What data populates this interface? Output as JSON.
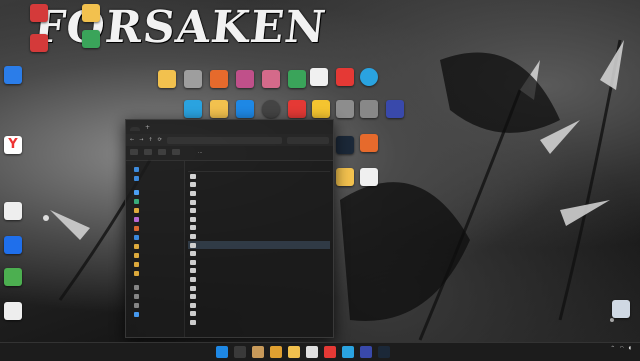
{
  "wallpaper": {
    "title": "FORSAKEN"
  },
  "desktop_icons": [
    {
      "name": "app-icon-1",
      "caption": "",
      "color": "#d43a3a"
    },
    {
      "name": "app-icon-2",
      "caption": "",
      "color": "#2b7de9"
    },
    {
      "name": "app-icon-3",
      "caption": "",
      "color": "#f2c14e"
    },
    {
      "name": "app-icon-4",
      "caption": "",
      "color": "#3aa45a"
    },
    {
      "name": "yandex-icon",
      "caption": "",
      "color": "#e93b3b"
    },
    {
      "name": "file-icon",
      "caption": "",
      "color": "#e8e8e8"
    },
    {
      "name": "app-icon-5",
      "caption": "",
      "color": "#1f6feb"
    },
    {
      "name": "app-icon-6",
      "caption": "",
      "color": "#4caf50"
    },
    {
      "name": "file-icon-2",
      "caption": "",
      "color": "#e8e8e8"
    },
    {
      "name": "telegram-icon",
      "caption": "",
      "color": "#2aa3e0"
    },
    {
      "name": "roblox-icon",
      "caption": "",
      "color": "#f0f0f0"
    },
    {
      "name": "steam-icon",
      "caption": "",
      "color": "#1b2838"
    },
    {
      "name": "folder-icon",
      "caption": "",
      "color": "#f2c14e"
    },
    {
      "name": "recycle-bin-icon",
      "caption": "",
      "color": "#cfd8e3"
    }
  ],
  "explorer": {
    "tab_title": "",
    "address": "",
    "search_placeholder": "",
    "toolbar_items": [
      "",
      "",
      "",
      "",
      ""
    ],
    "columns": {
      "name": "",
      "date": ""
    },
    "sidebar": [
      "",
      "",
      "",
      "",
      "",
      "",
      "",
      "",
      "",
      "",
      "",
      "",
      "",
      "",
      "",
      ""
    ],
    "files": [
      {
        "name": "",
        "date": ""
      },
      {
        "name": "",
        "date": ""
      },
      {
        "name": "",
        "date": ""
      },
      {
        "name": "",
        "date": ""
      },
      {
        "name": "",
        "date": ""
      },
      {
        "name": "",
        "date": ""
      },
      {
        "name": "",
        "date": ""
      },
      {
        "name": "",
        "date": ""
      },
      {
        "name": "",
        "date": ""
      },
      {
        "name": "",
        "date": ""
      },
      {
        "name": "",
        "date": ""
      },
      {
        "name": "",
        "date": ""
      },
      {
        "name": "",
        "date": ""
      },
      {
        "name": "",
        "date": ""
      },
      {
        "name": "",
        "date": ""
      },
      {
        "name": "",
        "date": ""
      },
      {
        "name": "",
        "date": ""
      },
      {
        "name": "",
        "date": ""
      }
    ]
  },
  "taskbar": {
    "apps": [
      "#1e88e5",
      "#f2c14e",
      "#e0e0e0",
      "#e53935",
      "#2aa3e0",
      "#3949ab"
    ],
    "time": "",
    "date": ""
  }
}
